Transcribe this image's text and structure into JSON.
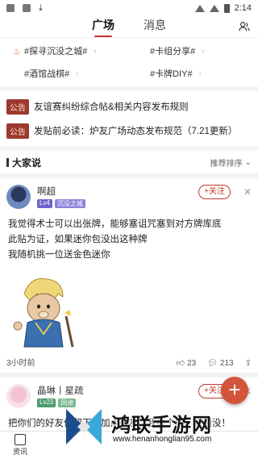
{
  "status": {
    "time": "2:14"
  },
  "tabs": [
    {
      "label": "广场"
    },
    {
      "label": "消息"
    }
  ],
  "topics": [
    {
      "label": "#探寻沉没之城#"
    },
    {
      "label": "#卡组分享#"
    },
    {
      "label": "#酒馆战棋#"
    },
    {
      "label": "#卡牌DIY#"
    }
  ],
  "notices": [
    {
      "badge": "公告",
      "text": "友谊赛纠纷综合帖&相关内容发布规则"
    },
    {
      "badge": "公告",
      "text": "发贴前必读：炉友广场动态发布规范（7.21更新）"
    }
  ],
  "section": {
    "title": "大家说",
    "sort_label": "推荐排序"
  },
  "posts": [
    {
      "username": "啊超",
      "level": "Lv4",
      "tag": "沉没之城",
      "follow_label": "+关注",
      "lines": [
        "我觉得术士可以出张牌，能够塞诅咒塞到对方牌库底",
        "此贴为证，如果迷你包没出这种牌",
        "我随机挑一位送金色迷你"
      ],
      "time": "3小时前",
      "likes": "23",
      "comments": "213"
    },
    {
      "username": "晶琳丨星疏",
      "level": "Lv23",
      "tag": "同卓",
      "follow_label": "+关注",
      "lines": [
        "把你们的好友份留下，加点好友，我挨个加！听到没！"
      ]
    }
  ],
  "bottom_nav": [
    {
      "label": "资讯"
    }
  ],
  "watermark": {
    "title": "鸿联手游网",
    "url": "www.henanhonglian95.com"
  },
  "colors": {
    "accent": "#c0392b",
    "notice_bg": "#9b3a2c",
    "fab": "#d2553b"
  }
}
